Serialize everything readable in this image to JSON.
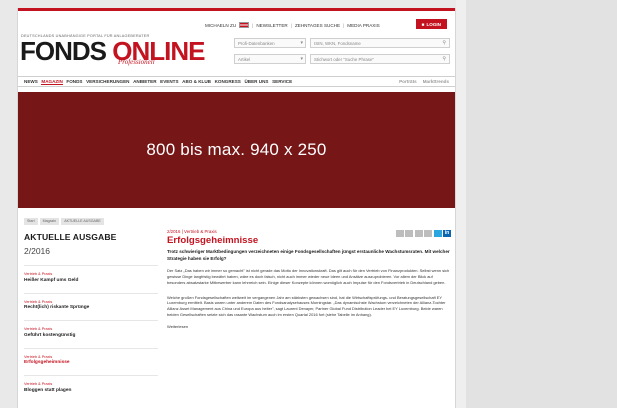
{
  "utility_bar": {
    "items": [
      "MICHAELN ZU",
      "NEWSLETTER",
      "ZEHNTAGES SUCHE",
      "ABOS & SHOP",
      "MEDIA PRAXIS"
    ],
    "login_label": "LOGIN"
  },
  "logo": {
    "tagline": "DEUTSCHLANDS UNABHÄNGIGE PORTAL FÜR ANLAGEBERATER",
    "word_fonds": "FONDS",
    "word_online": "ONLINE",
    "sub": "Professionell"
  },
  "search": {
    "fund_select_placeholder": "Profi-Datenbanken",
    "isin_placeholder": "ISIN, WKN, Fondsname",
    "category_select_placeholder": "Artikel",
    "keyword_placeholder": "Stichwort oder \"Suche Phrase\""
  },
  "nav": {
    "items": [
      "NEWS",
      "MAGAZIN",
      "FONDS",
      "VERSICHERUNGEN",
      "ANBIETER",
      "EVENTS",
      "ABO & KLUB",
      "KONGRESS",
      "ÜBER UNS",
      "SERVICE"
    ],
    "active_index": 1,
    "right_items": [
      "Porträts",
      "Markttrends"
    ]
  },
  "ad": {
    "text": "800 bis max. 940 x 250"
  },
  "breadcrumb": [
    "Start",
    "Magazin",
    "AKTUELLE AUSGABE"
  ],
  "left_column": {
    "heading": "AKTUELLE AUSGABE",
    "issue": "2/2016",
    "items": [
      {
        "category": "Vertrieb & Praxis",
        "title": "Heißer Kampf ums Geld"
      },
      {
        "category": "Vertrieb & Praxis",
        "title": "Recht(lich) riskante Sprünge"
      },
      {
        "category": "Vertrieb & Praxis",
        "title": "Geführt kostengünstig"
      },
      {
        "category": "Vertrieb & Praxis",
        "title": "Erfolgsgeheimnisse"
      },
      {
        "category": "Vertrieb & Praxis",
        "title": "Bloggen statt plagen"
      }
    ],
    "current_index": 3
  },
  "article": {
    "kicker": "2/2016 | Vertrieb & Praxis",
    "title": "Erfolgsgeheimnisse",
    "lead": "Trotz schwieriger Marktbedingungen verzeichneten einige Fondsgesellschaften jüngst erstaunliche Wachstumsraten. Mit welcher Strategie haben sie Erfolg?",
    "paragraphs": [
      "Der Satz „Das haben wir immer so gemacht\" ist nicht gerade das Motto der Innovationskraft. Das gilt auch für den Vertrieb von Finanzprodukten. Selbst wenn sich gewisse Dinge langfristig bewährt haben, wäre es doch falsch, nicht auch immer wieder neue Ideen und Ansätze auszuprobieren. Vor allem der Blick auf besonders absatzstarke Mitbewerber kann lehrreich sein. Einige dieser Konzepte können womöglich auch Impulse für den Fondsvertrieb in Deutschland geben.",
      "Welche großen Fondsgesellschaften weltweit im vergangenen Jahr am stärksten gewachsen sind, hat die Wirtschaftsprüfungs- und Beratungsgesellschaft EY Luxemburg ermittelt. Basis waren unter anderem Daten des Fondsanalysehauses Morningstar. „Das dynamischste Wachstum verzeichneten der Allianz-Tochter Allianz Asset Management aus China und Europa aus heiter\", sagt Laurent Denayer, Partner Global Fund Distribution Leader bei EY Luxemburg. Beide waren beiden Gesellschaften setzte sich das rasante Wachstum auch im ersten Quartal 2016 fort (siehe Tabelle im Anhang)."
    ],
    "more": "Weiterlesen"
  }
}
